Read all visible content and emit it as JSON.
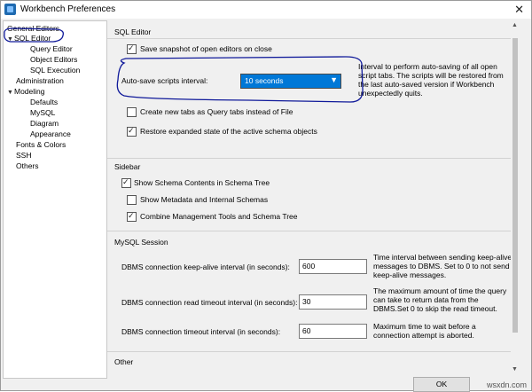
{
  "window": {
    "title": "Workbench Preferences",
    "close": "✕"
  },
  "sidebar": {
    "items": [
      {
        "label": "General Editors"
      },
      {
        "label": "SQL Editor"
      },
      {
        "label": "Query Editor"
      },
      {
        "label": "Object Editors"
      },
      {
        "label": "SQL Execution"
      },
      {
        "label": "Administration"
      },
      {
        "label": "Modeling"
      },
      {
        "label": "Defaults"
      },
      {
        "label": "MySQL"
      },
      {
        "label": "Diagram"
      },
      {
        "label": "Appearance"
      },
      {
        "label": "Fonts & Colors"
      },
      {
        "label": "SSH"
      },
      {
        "label": "Others"
      }
    ]
  },
  "sql_editor": {
    "section_title": "SQL Editor",
    "save_snapshot": {
      "label": "Save snapshot of open editors on close",
      "checked": true
    },
    "autosave": {
      "label": "Auto-save scripts interval:",
      "value": "10 seconds",
      "description": "Interval to perform auto-saving of all open script tabs. The scripts will be restored from the last auto-saved version if Workbench unexpectedly quits."
    },
    "new_tabs": {
      "label": "Create new tabs as Query tabs instead of File",
      "checked": false
    },
    "restore_state": {
      "label": "Restore expanded state of the active schema objects",
      "checked": true
    }
  },
  "sidebar_section": {
    "title": "Sidebar",
    "show_schema": {
      "label": "Show Schema Contents in Schema Tree",
      "checked": true
    },
    "show_metadata": {
      "label": "Show Metadata and Internal Schemas",
      "checked": false
    },
    "combine_tools": {
      "label": "Combine Management Tools and Schema Tree",
      "checked": true
    }
  },
  "mysql_session": {
    "title": "MySQL Session",
    "keepalive": {
      "label": "DBMS connection keep-alive interval (in seconds):",
      "value": "600",
      "description": "Time interval between sending keep-alive messages to DBMS. Set to 0 to not send keep-alive messages."
    },
    "read_timeout": {
      "label": "DBMS connection read timeout interval (in seconds):",
      "value": "30",
      "description": "The maximum amount of time the query can take to return data from the DBMS.Set 0 to skip the read timeout."
    },
    "conn_timeout": {
      "label": "DBMS connection timeout interval (in seconds):",
      "value": "60",
      "description": "Maximum time to wait before a connection attempt is aborted."
    }
  },
  "other_section": {
    "title": "Other"
  },
  "buttons": {
    "ok": "OK"
  },
  "watermark": "wsxdn.com",
  "colors": {
    "annotation": "#101a9a",
    "selection": "#0078d7"
  }
}
